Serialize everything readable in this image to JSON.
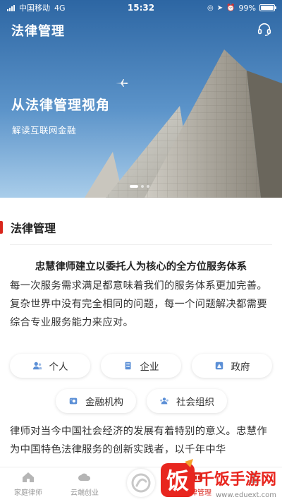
{
  "status_bar": {
    "carrier": "中国移动",
    "network": "4G",
    "time": "15:32",
    "battery": "99%",
    "battery_level": 0.99
  },
  "header": {
    "title": "法律管理",
    "support_icon": "headset-icon"
  },
  "banner": {
    "title": "从法律管理视角",
    "subtitle": "解读互联网金融",
    "slide_count": 3,
    "active_slide": 1
  },
  "section": {
    "title": "法律管理",
    "accent_color": "#d9261c",
    "lead": "忠慧律师建立以委托人为核心的全方位服务体系",
    "paragraph": "每一次服务需求满足都意味着我们的服务体系更加完善。复杂世界中没有完全相同的问题，每一个问题解决都需要综合专业服务能力来应对。",
    "paragraph2": "律师对当今中国社会经济的发展有着特别的意义。忠慧作为中国特色法律服务的创新实践者，以千年中华"
  },
  "categories": [
    {
      "label": "个人",
      "icon": "person-icon"
    },
    {
      "label": "企业",
      "icon": "building-icon"
    },
    {
      "label": "政府",
      "icon": "government-icon"
    },
    {
      "label": "金融机构",
      "icon": "finance-icon"
    },
    {
      "label": "社会组织",
      "icon": "group-icon"
    }
  ],
  "tabbar": {
    "tabs": [
      {
        "label": "家庭律师",
        "icon": "home-icon"
      },
      {
        "label": "云端创业",
        "icon": "cloud-icon"
      },
      {
        "label": "",
        "icon": "center-logo-icon"
      },
      {
        "label": "法律管理",
        "icon": "law-icon"
      },
      {
        "label": "",
        "icon": "profile-icon"
      }
    ],
    "active_index": 3,
    "active_color": "#d9261c"
  },
  "watermark": {
    "text": "千饭手游网",
    "url": "www.eduext.com",
    "logo_char": "饭"
  }
}
